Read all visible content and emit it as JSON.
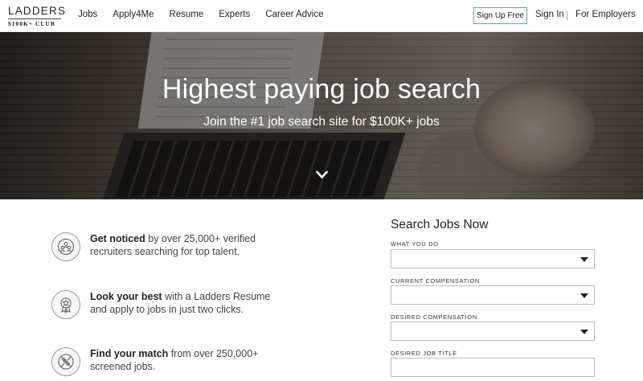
{
  "header": {
    "logo_main": "LADDERS",
    "logo_sub": "$100K+ CLUB",
    "nav": [
      "Jobs",
      "Apply4Me",
      "Resume",
      "Experts",
      "Career Advice"
    ],
    "signup": "Sign Up Free",
    "signin": "Sign In",
    "employers": "For Employers"
  },
  "hero": {
    "title": "Highest paying job search",
    "subtitle": "Join the #1 job search site for $100K+ jobs"
  },
  "features": [
    {
      "icon": "recruiters-icon",
      "bold": "Get noticed",
      "text": " by over 25,000+ verified recruiters searching for top talent."
    },
    {
      "icon": "award-ribbon-icon",
      "bold": "Look your best",
      "text": " with a Ladders Resume and apply to jobs in just two clicks."
    },
    {
      "icon": "match-icon",
      "bold": "Find your match",
      "text": " from over 250,000+ screened jobs."
    }
  ],
  "search": {
    "title": "Search Jobs Now",
    "fields": [
      {
        "label": "WHAT YOU DO",
        "type": "select",
        "value": ""
      },
      {
        "label": "CURRENT COMPENSATION",
        "type": "select",
        "value": ""
      },
      {
        "label": "DESIRED COMPENSATION",
        "type": "select",
        "value": ""
      },
      {
        "label": "DESIRED JOB TITLE",
        "type": "text",
        "value": ""
      }
    ]
  },
  "colors": {
    "signup_border": "#5aa9b9",
    "overlay": "rgba(0,0,0,0.32)"
  }
}
